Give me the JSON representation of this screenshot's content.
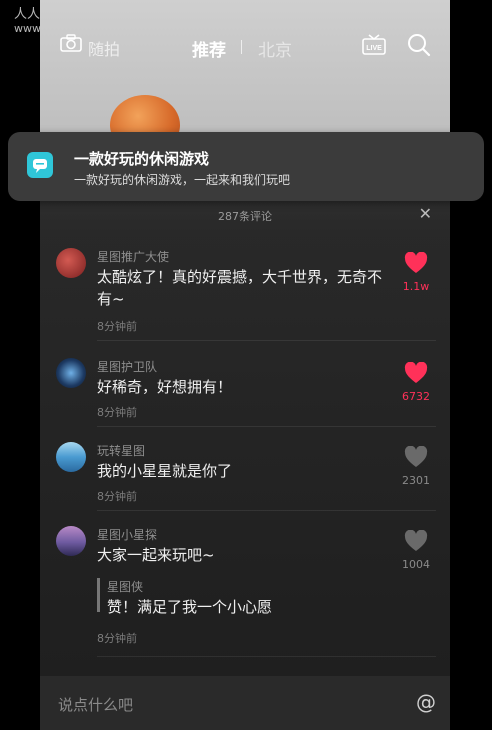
{
  "watermark": {
    "line1": "人人都是产品经理",
    "line2": "www.woshipm.com"
  },
  "top_nav": {
    "capture_label": "随拍",
    "tabs": [
      {
        "label": "推荐"
      },
      {
        "label": "北京"
      }
    ],
    "live_label": "LIVE"
  },
  "notification": {
    "title": "一款好玩的休闲游戏",
    "body": "一款好玩的休闲游戏，一起来和我们玩吧"
  },
  "comments_sheet": {
    "title": "287条评论",
    "comments": [
      {
        "user": "星图推广大使",
        "text": "太酷炫了！真的好震撼，大千世界，无奇不有~",
        "time": "8分钟前",
        "likes": "1.1w",
        "liked": true
      },
      {
        "user": "星图护卫队",
        "text": "好稀奇，好想拥有！",
        "time": "8分钟前",
        "likes": "6732",
        "liked": true
      },
      {
        "user": "玩转星图",
        "text": "我的小星星就是你了",
        "time": "8分钟前",
        "likes": "2301",
        "liked": false
      },
      {
        "user": "星图小星探",
        "text": "大家一起来玩吧~",
        "time": "8分钟前",
        "likes": "1004",
        "liked": false,
        "reply": {
          "user": "星图侠",
          "text": "赞！满足了我一个小心愿"
        }
      }
    ]
  },
  "input": {
    "placeholder": "说点什么吧"
  },
  "colors": {
    "like_red": "#ff3159",
    "app_icon": "#2fc6d8"
  }
}
